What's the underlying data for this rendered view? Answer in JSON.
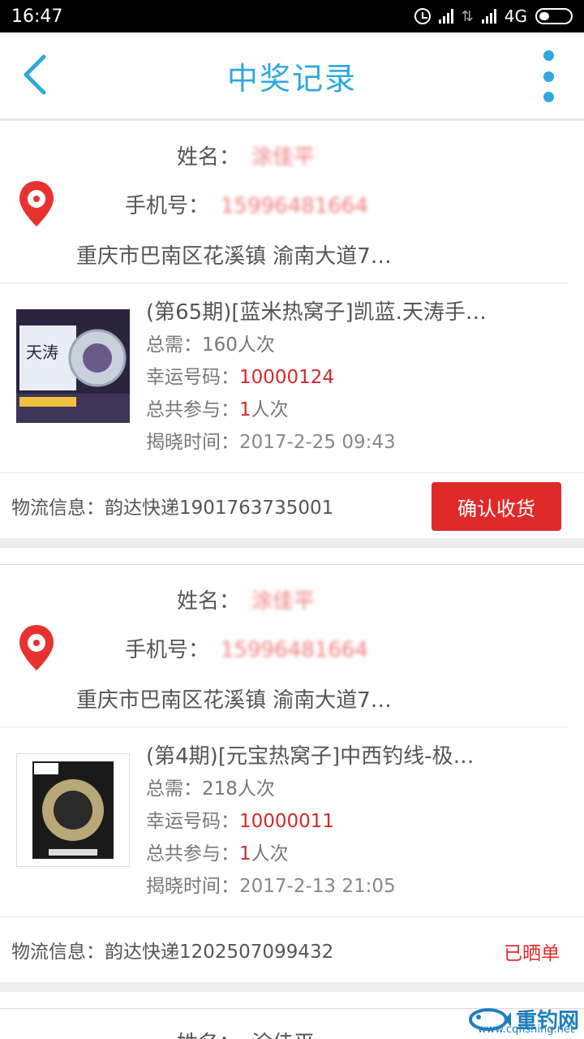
{
  "status": {
    "time": "16:47",
    "network": "4G"
  },
  "header": {
    "title": "中奖记录"
  },
  "cards": [
    {
      "name_label": "姓名：",
      "name_value": "涂佳平",
      "phone_label": "手机号：",
      "phone_value": "15996481664",
      "address": "重庆市巴南区花溪镇 渝南大道7…",
      "product_title": "(第65期)[蓝米热窝子]凯蓝.天涛手…",
      "need_label": "总需：",
      "need_value": "160人次",
      "lucky_label": "幸运号码：",
      "lucky_value": "10000124",
      "join_label": "总共参与：",
      "join_count": "1",
      "join_unit": "人次",
      "reveal_label": "揭晓时间：",
      "reveal_value": "2017-2-25 09:43",
      "logistics_label": "物流信息：",
      "logistics_value": "韵达快递1901763735001",
      "action": "确认收货"
    },
    {
      "name_label": "姓名：",
      "name_value": "涂佳平",
      "phone_label": "手机号：",
      "phone_value": "15996481664",
      "address": "重庆市巴南区花溪镇 渝南大道7…",
      "product_title": "(第4期)[元宝热窝子]中西钓线-极…",
      "need_label": "总需：",
      "need_value": "218人次",
      "lucky_label": "幸运号码：",
      "lucky_value": "10000011",
      "join_label": "总共参与：",
      "join_count": "1",
      "join_unit": "人次",
      "reveal_label": "揭晓时间：",
      "reveal_value": "2017-2-13 21:05",
      "logistics_label": "物流信息：",
      "logistics_value": "韵达快递1202507099432",
      "status_tag": "已晒单"
    },
    {
      "name_label": "姓名：",
      "name_value": "涂佳平"
    }
  ],
  "watermark": {
    "brand": "重钓网",
    "site": "www.cqfishing.net"
  },
  "colors": {
    "accent": "#2fa9dd",
    "danger": "#e02a2a"
  }
}
